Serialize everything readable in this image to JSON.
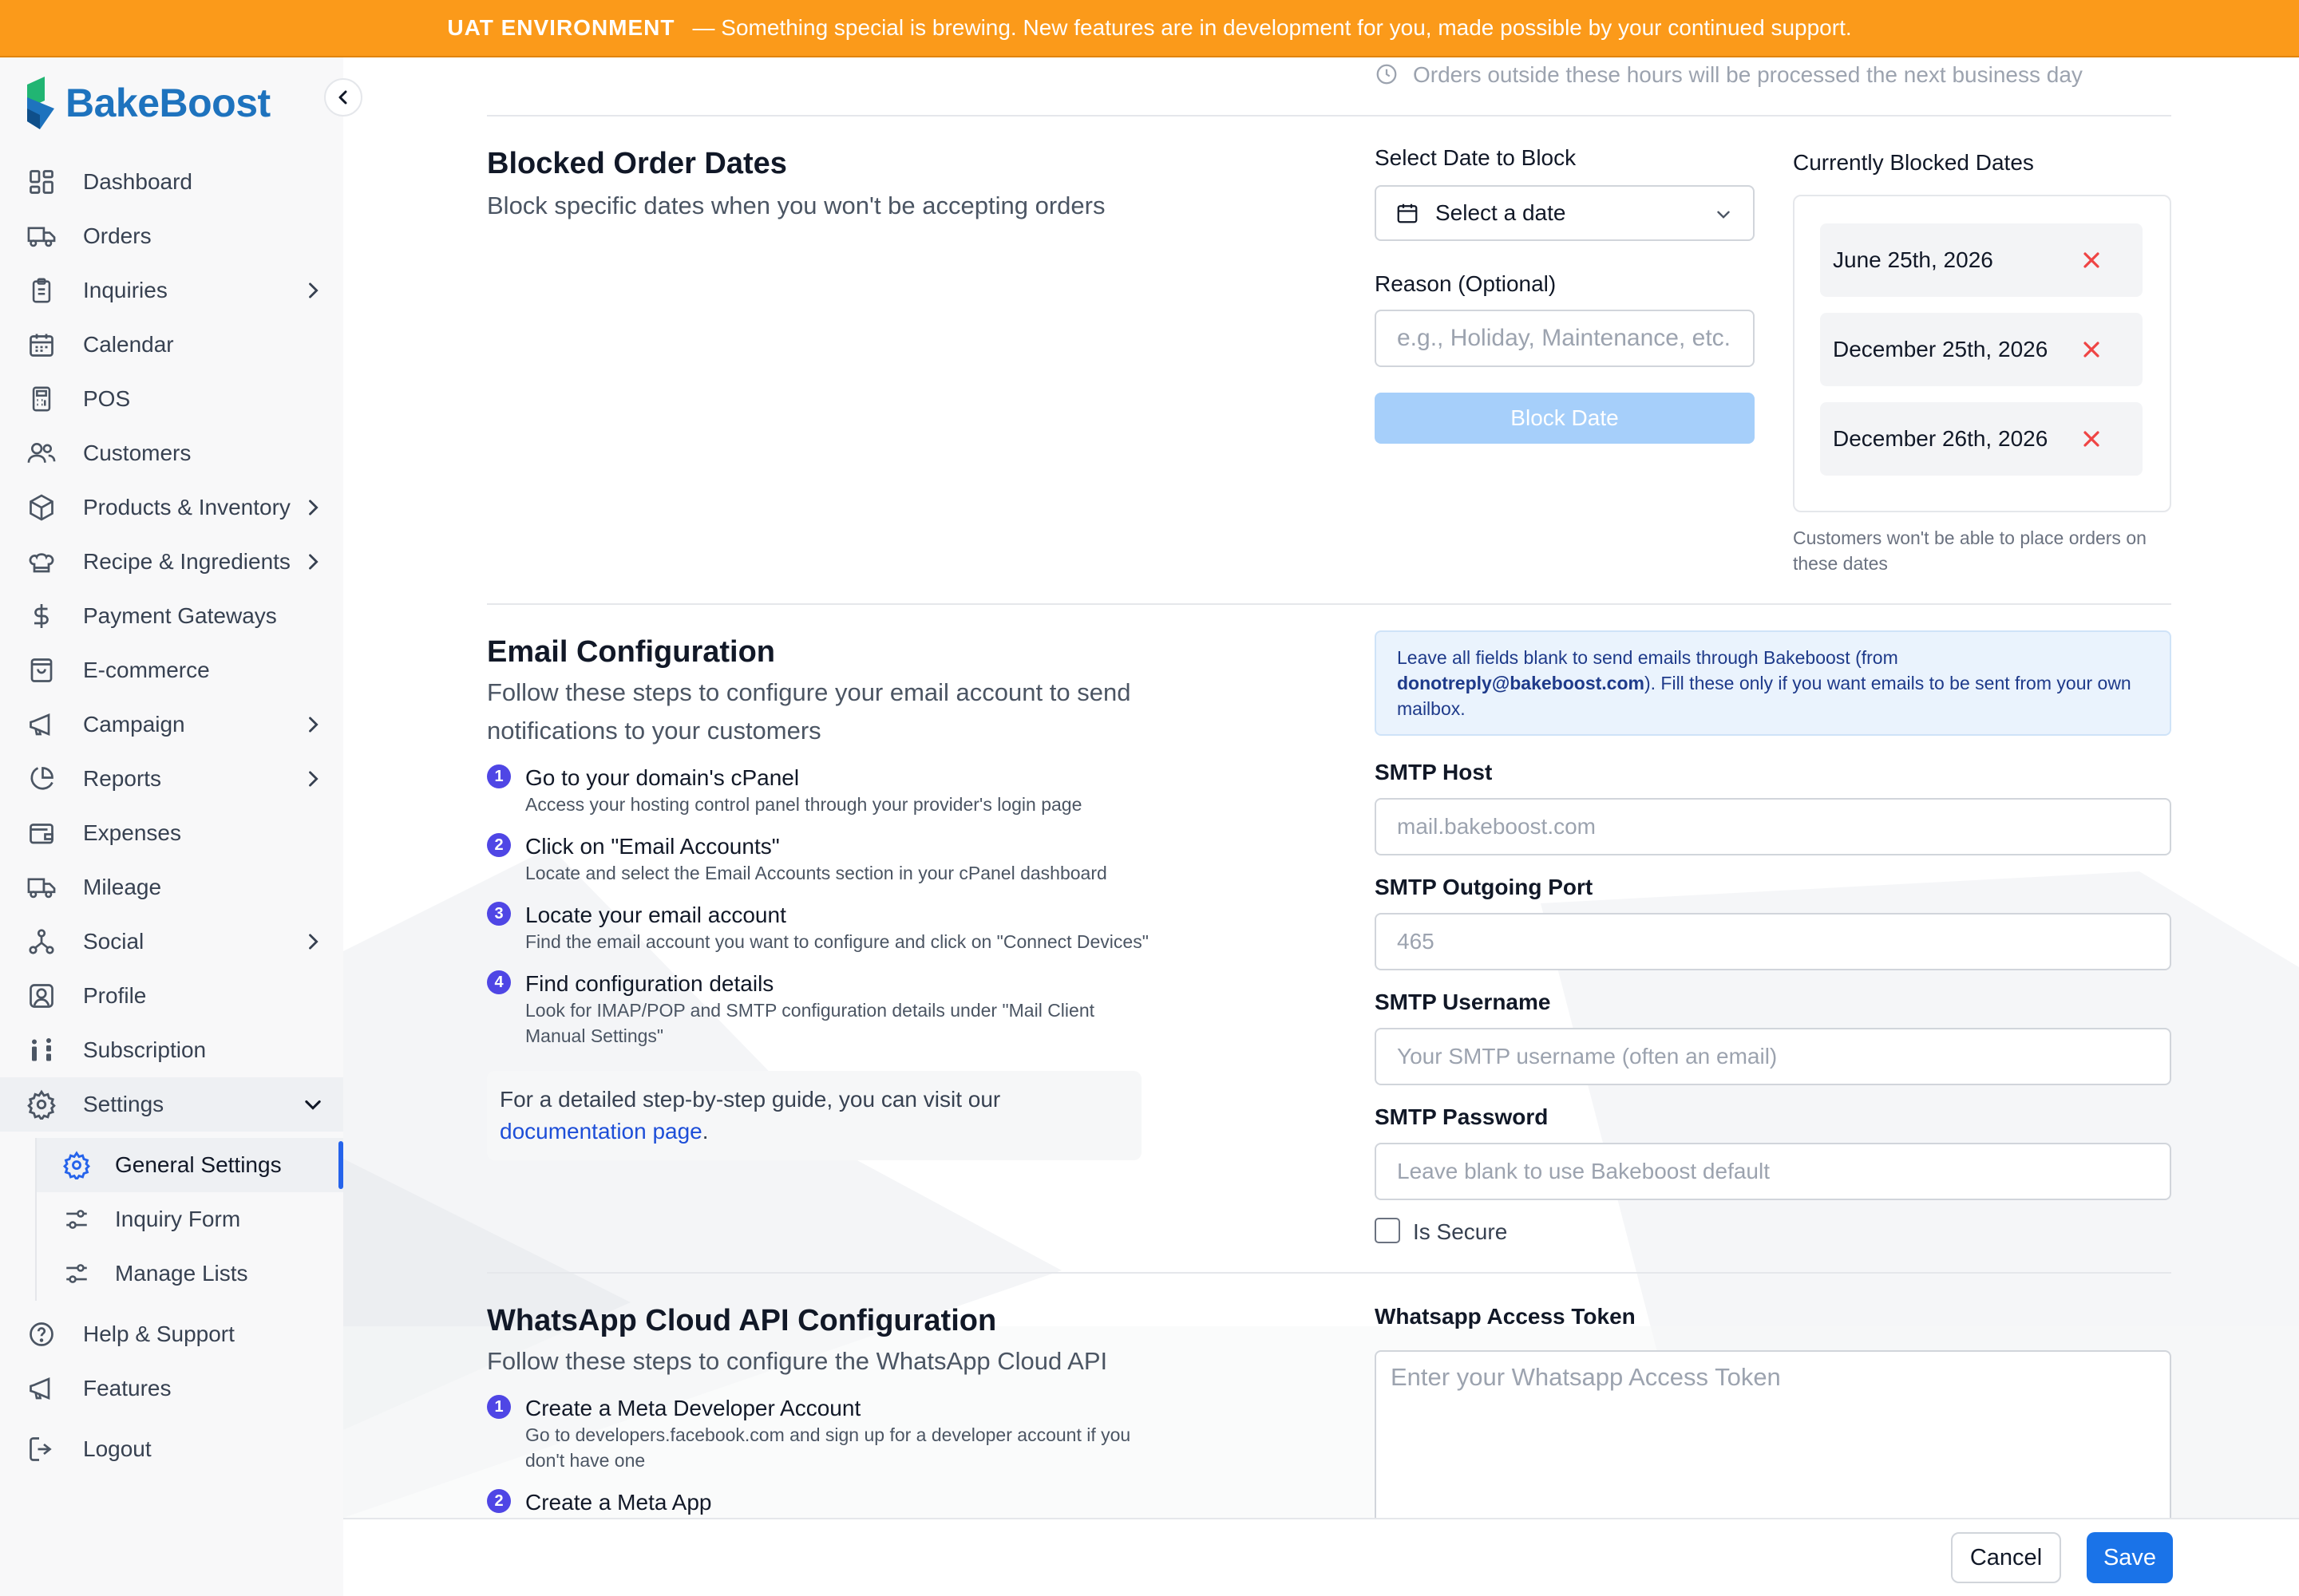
{
  "banner": {
    "env_label": "UAT ENVIRONMENT",
    "message": "— Something special is brewing. New features are in development for you, made possible by your continued support."
  },
  "brand": {
    "name": "BakeBoost",
    "color": "#1e73be"
  },
  "sidebar": {
    "items": [
      {
        "label": "Dashboard",
        "icon": "dashboard-icon"
      },
      {
        "label": "Orders",
        "icon": "truck-icon"
      },
      {
        "label": "Inquiries",
        "icon": "clipboard-icon"
      },
      {
        "label": "Calendar",
        "icon": "calendar-icon"
      },
      {
        "label": "POS",
        "icon": "calculator-icon"
      },
      {
        "label": "Customers",
        "icon": "users-icon"
      },
      {
        "label": "Products & Inventory",
        "icon": "box-icon"
      },
      {
        "label": "Recipe & Ingredients",
        "icon": "chef-hat-icon"
      },
      {
        "label": "Payment Gateways",
        "icon": "dollar-icon"
      },
      {
        "label": "E-commerce",
        "icon": "shopping-bag-icon"
      },
      {
        "label": "Campaign",
        "icon": "megaphone-icon"
      },
      {
        "label": "Reports",
        "icon": "pie-chart-icon"
      },
      {
        "label": "Expenses",
        "icon": "wallet-icon"
      },
      {
        "label": "Mileage",
        "icon": "truck-icon"
      },
      {
        "label": "Social",
        "icon": "share-icon"
      },
      {
        "label": "Profile",
        "icon": "user-square-icon"
      },
      {
        "label": "Subscription",
        "icon": "subscription-icon"
      },
      {
        "label": "Settings",
        "icon": "gear-icon"
      }
    ],
    "settings_sub": [
      {
        "label": "General Settings",
        "icon": "gear-icon"
      },
      {
        "label": "Inquiry Form",
        "icon": "sliders-icon"
      },
      {
        "label": "Manage Lists",
        "icon": "sliders-icon"
      }
    ],
    "bottom": [
      {
        "label": "Help & Support",
        "icon": "help-icon"
      },
      {
        "label": "Features",
        "icon": "megaphone-icon"
      },
      {
        "label": "Logout",
        "icon": "logout-icon"
      }
    ]
  },
  "hours_note": "Orders outside these hours will be processed the next business day",
  "blocked": {
    "title": "Blocked Order Dates",
    "subtitle": "Block specific dates when you won't be accepting orders",
    "select_label": "Select Date to Block",
    "select_placeholder": "Select a date",
    "reason_label": "Reason (Optional)",
    "reason_placeholder": "e.g., Holiday, Maintenance, etc.",
    "block_button": "Block Date",
    "current_label": "Currently Blocked Dates",
    "dates": [
      "June 25th, 2026",
      "December 25th, 2026",
      "December 26th, 2026"
    ],
    "note": "Customers won't be able to place orders on these dates"
  },
  "email": {
    "title": "Email Configuration",
    "subtitle": "Follow these steps to configure your email account to send notifications to your customers",
    "steps": [
      {
        "num": "1",
        "title": "Go to your domain's cPanel",
        "desc": "Access your hosting control panel through your provider's login page"
      },
      {
        "num": "2",
        "title": "Click on \"Email Accounts\"",
        "desc": "Locate and select the Email Accounts section in your cPanel dashboard"
      },
      {
        "num": "3",
        "title": "Locate your email account",
        "desc": "Find the email account you want to configure and click on \"Connect Devices\""
      },
      {
        "num": "4",
        "title": "Find configuration details",
        "desc": "Look for IMAP/POP and SMTP configuration details under \"Mail Client Manual Settings\""
      }
    ],
    "guide_text": "For a detailed step-by-step guide, you can visit our ",
    "guide_link": "documentation page",
    "guide_end": ".",
    "info_pre": "Leave all fields blank to send emails through Bakeboost (from ",
    "info_email": "donotreply@bakeboost.com",
    "info_post": "). Fill these only if you want emails to be sent from your own mailbox.",
    "smtp_host_label": "SMTP Host",
    "smtp_host_placeholder": "mail.bakeboost.com",
    "smtp_port_label": "SMTP Outgoing Port",
    "smtp_port_placeholder": "465",
    "smtp_user_label": "SMTP Username",
    "smtp_user_placeholder": "Your SMTP username (often an email)",
    "smtp_pass_label": "SMTP Password",
    "smtp_pass_placeholder": "Leave blank to use Bakeboost default",
    "is_secure_label": "Is Secure"
  },
  "whatsapp": {
    "title": "WhatsApp Cloud API Configuration",
    "subtitle": "Follow these steps to configure the WhatsApp Cloud API",
    "steps": [
      {
        "num": "1",
        "title": "Create a Meta Developer Account",
        "desc": "Go to developers.facebook.com and sign up for a developer account if you don't have one"
      },
      {
        "num": "2",
        "title": "Create a Meta App",
        "desc": ""
      }
    ],
    "token_label": "Whatsapp Access Token",
    "token_placeholder": "Enter your Whatsapp Access Token"
  },
  "footer": {
    "cancel": "Cancel",
    "save": "Save"
  },
  "colors": {
    "banner": "#fb9a1a",
    "primary": "#1a73e8",
    "danger": "#ef4444",
    "step_badge": "#4f46e5"
  }
}
